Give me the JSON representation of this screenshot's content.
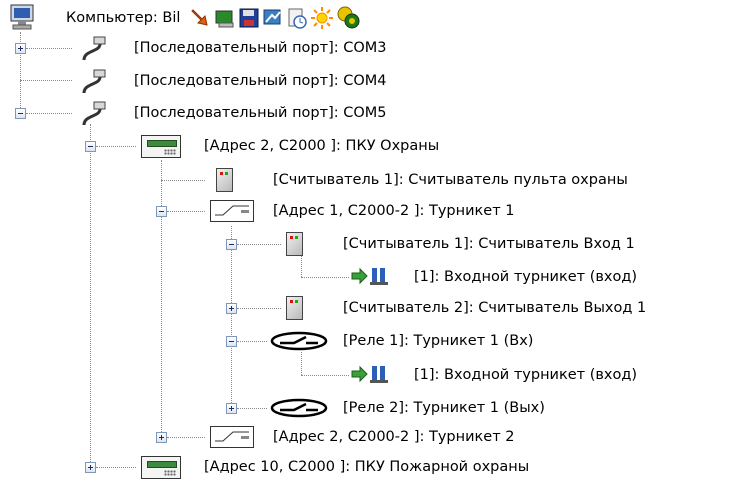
{
  "header": {
    "computer_label": "Компьютер: Bil",
    "toolbar_icons": [
      "computer-icon",
      "hand-icon",
      "monitor-icon",
      "floppy-icon",
      "network-icon",
      "clock-page-icon",
      "sun-icon",
      "coins-icon"
    ]
  },
  "tree": {
    "com3": "[Последовательный порт]: COM3",
    "com4": "[Последовательный порт]: COM4",
    "com5": "[Последовательный порт]: COM5",
    "pku_ohrany": "[Адрес 2, С2000 ]: ПКУ Охраны",
    "reader_pulta": "[Считыватель 1]: Считыватель пульта охраны",
    "turnstile1": "[Адрес 1, С2000-2 ]: Турникет 1",
    "reader_in": "[Считыватель 1]: Считыватель Вход 1",
    "in_turnstile_1": "[1]: Входной турникет (вход)",
    "reader_out": "[Считыватель 2]: Считыватель Выход 1",
    "relay1": "[Реле 1]: Турникет 1 (Вх)",
    "in_turnstile_2": "[1]: Входной турникет (вход)",
    "relay2": "[Реле 2]: Турникет 1 (Вых)",
    "turnstile2": "[Адрес 2, С2000-2 ]: Турникет 2",
    "pku_fire": "[Адрес 10, С2000 ]: ПКУ Пожарной охраны"
  },
  "colors": {
    "panel_screen": "#3e8b3e",
    "reader_red": "#e01010",
    "reader_green": "#10b010",
    "tree_lines": "#8a8a8a"
  }
}
